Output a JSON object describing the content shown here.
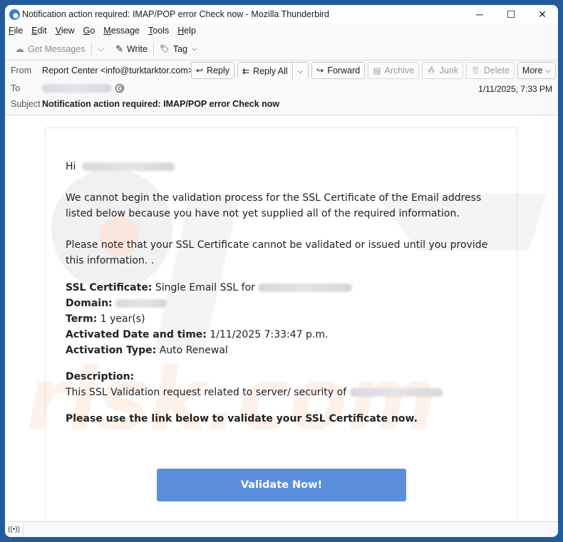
{
  "window": {
    "title": "Notification action required: IMAP/POP error Check now - Mozilla Thunderbird",
    "controls": {
      "minimize": "─",
      "maximize": "☐",
      "close": "✕"
    }
  },
  "menubar": {
    "items": [
      {
        "label": "File",
        "accel": "F",
        "rest": "ile"
      },
      {
        "label": "Edit",
        "accel": "E",
        "rest": "dit"
      },
      {
        "label": "View",
        "accel": "V",
        "rest": "iew"
      },
      {
        "label": "Go",
        "accel": "G",
        "rest": "o"
      },
      {
        "label": "Message",
        "accel": "M",
        "rest": "essage"
      },
      {
        "label": "Tools",
        "accel": "T",
        "rest": "ools"
      },
      {
        "label": "Help",
        "accel": "H",
        "rest": "elp"
      }
    ]
  },
  "toolbar": {
    "get_messages": "Get Messages",
    "write": "Write",
    "tag": "Tag",
    "icons": {
      "get_messages": "☁",
      "write": "✎",
      "tag": "🏷",
      "chevron": "⌵"
    }
  },
  "header": {
    "from_label": "From",
    "from_value": "Report Center <info@turktarktor.com>",
    "to_label": "To",
    "subject_label": "Subject",
    "subject_value": "Notification action required: IMAP/POP error Check now",
    "date": "1/11/2025, 7:33 PM",
    "actions": {
      "reply": "Reply",
      "reply_all": "Reply All",
      "forward": "Forward",
      "archive": "Archive",
      "junk": "Junk",
      "delete": "Delete",
      "more": "More"
    },
    "action_icons": {
      "reply": "↩",
      "reply_all": "⇇",
      "forward": "↪",
      "archive": "▤",
      "junk": "🔥",
      "delete": "🗑",
      "chevron": "⌵"
    }
  },
  "email": {
    "greeting": "Hi",
    "para1": "We cannot begin the validation process for the SSL Certificate of the Email address listed below because you have not yet supplied all of the required information.",
    "para2": "Please note that your SSL Certificate cannot be validated or issued until you provide this information. .",
    "details": {
      "ssl_label": "SSL Certificate:",
      "ssl_value": "Single Email SSL for",
      "domain_label": "Domain:",
      "term_label": "Term:",
      "term_value": "1 year(s)",
      "activated_label": "Activated Date and time:",
      "activated_value": "1/11/2025 7:33:47 p.m.",
      "type_label": "Activation Type:",
      "type_value": "Auto Renewal"
    },
    "description_label": "Description:",
    "description_value": "This SSL Validation request related to server/ security of",
    "cta_text": "Please use the link below to validate your SSL Certificate now.",
    "button_label": "Validate Now!",
    "button_color": "#5b8fdb"
  },
  "statusbar": {
    "icon": "((•))"
  }
}
